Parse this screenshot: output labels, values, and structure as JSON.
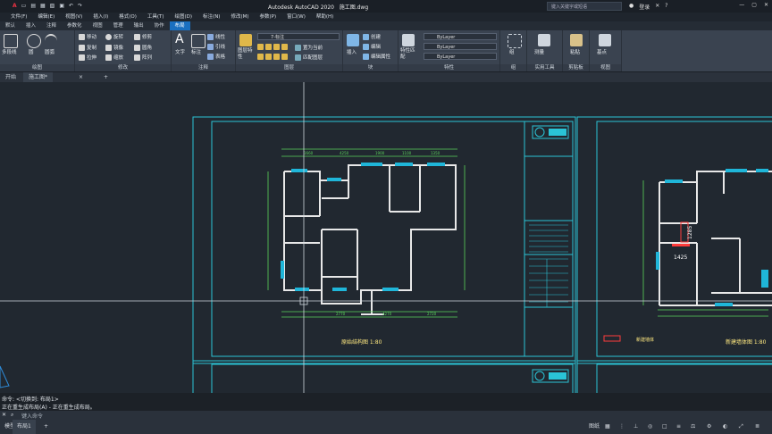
{
  "titlebar": {
    "app_title": "Autodesk AutoCAD 2020",
    "file_name": "施工图.dwg",
    "search_placeholder": "键入关键字或短语",
    "user": "登录"
  },
  "menu": [
    "文件(F)",
    "编辑(E)",
    "视图(V)",
    "插入(I)",
    "格式(O)",
    "工具(T)",
    "绘图(D)",
    "标注(N)",
    "修改(M)",
    "参数(P)",
    "窗口(W)",
    "帮助(H)"
  ],
  "ribbon_tabs": [
    "默认",
    "插入",
    "注释",
    "参数化",
    "视图",
    "管理",
    "输出",
    "协作",
    "布局"
  ],
  "active_ribbon_tab": "布局",
  "ribbon": {
    "draw": {
      "label": "绘图",
      "items": [
        "多段线",
        "圆",
        "圆弧"
      ]
    },
    "modify": {
      "label": "修改",
      "items": [
        "移动",
        "旋转",
        "修剪",
        "复制",
        "镜像",
        "圆角",
        "拉伸",
        "缩放",
        "阵列"
      ]
    },
    "annotation": {
      "label": "注释",
      "items": [
        "文字",
        "标注",
        "线性",
        "引线",
        "表格"
      ]
    },
    "layers": {
      "label": "图层",
      "current": "7-标注",
      "items": [
        "图层特性",
        "置为当前",
        "匹配图层"
      ]
    },
    "block": {
      "label": "块",
      "items": [
        "插入",
        "创建",
        "编辑",
        "编辑属性"
      ]
    },
    "properties": {
      "label": "特性",
      "items": [
        "特性匹配"
      ],
      "combos": [
        "ByLayer",
        "ByLayer",
        "ByLayer"
      ]
    },
    "groups": {
      "label": "组",
      "items": [
        "组"
      ]
    },
    "utilities": {
      "label": "实用工具",
      "items": [
        "测量"
      ]
    },
    "clipboard": {
      "label": "剪贴板",
      "items": [
        "粘贴"
      ]
    },
    "view": {
      "label": "视图",
      "items": [
        "基点"
      ]
    }
  },
  "doc_tabs": [
    "开始",
    "施工图*"
  ],
  "drawing": {
    "sheet1_title": "原始结构图 1:80",
    "sheet2_title": "新建墙体图 1:80",
    "dims_top": [
      "1660",
      "4250",
      "1900",
      "1100",
      "1350"
    ],
    "dims_bottom": [
      "2770",
      "4270",
      "2720"
    ],
    "dim_1425": "1425",
    "dim_1285": "1285",
    "legend_label": "新建墙体"
  },
  "command": {
    "line1": "命令: <切换到: 布局1>",
    "line2": "正在重生成布局(A) - 正在重生成布局。",
    "prompt": "键入命令"
  },
  "layout_tabs": [
    "模型",
    "布局1"
  ],
  "active_layout": "布局1",
  "status": {
    "paper": "图纸"
  }
}
